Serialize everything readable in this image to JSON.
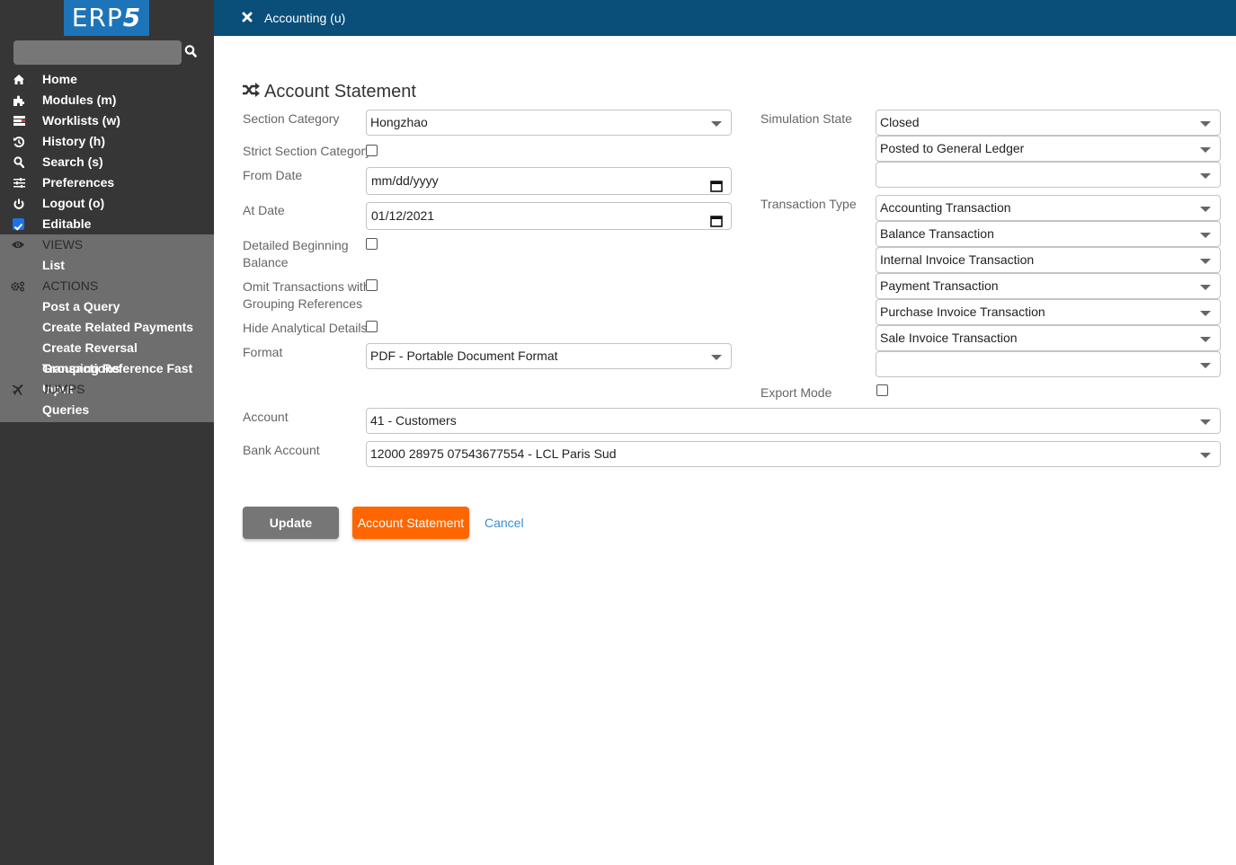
{
  "app": {
    "logo_text": "ERP",
    "logo_digit": "5",
    "brand_color": "#1d74b8",
    "header_color": "#0a4f7a",
    "accent_color": "#ff6600"
  },
  "sidebar": {
    "search": {
      "value": "",
      "placeholder": ""
    },
    "items": [
      {
        "label": "Home",
        "icon": "home-icon"
      },
      {
        "label": "Modules (m)",
        "icon": "puzzle-icon"
      },
      {
        "label": "Worklists (w)",
        "icon": "tasks-icon"
      },
      {
        "label": "History (h)",
        "icon": "history-icon"
      },
      {
        "label": "Search (s)",
        "icon": "search-icon"
      },
      {
        "label": "Preferences",
        "icon": "sliders-icon"
      },
      {
        "label": "Logout (o)",
        "icon": "power-icon"
      },
      {
        "label": "Editable",
        "icon": "checkbox-checked-icon",
        "checked": true
      }
    ],
    "sections": {
      "views": {
        "title": "VIEWS",
        "icon": "eye-icon",
        "items": [
          "List"
        ]
      },
      "actions": {
        "title": "ACTIONS",
        "icon": "cogs-icon",
        "items": [
          "Post a Query",
          "Create Related Payments",
          "Create Reversal Transactions",
          "Grouping Reference Fast Input"
        ]
      },
      "jumps": {
        "title": "JUMPS",
        "icon": "plane-icon",
        "items": [
          "Queries"
        ]
      }
    }
  },
  "header": {
    "title": "Accounting (u)",
    "close_icon": "close-icon"
  },
  "form": {
    "title": "Account Statement",
    "title_icon": "random-icon",
    "section_category": {
      "label": "Section Category",
      "value": "Hongzhao"
    },
    "strict_section_category": {
      "label": "Strict Section Category",
      "checked": false
    },
    "from_date": {
      "label": "From Date",
      "value": "",
      "placeholder": "mm/dd/yyyy"
    },
    "at_date": {
      "label": "At Date",
      "value": "01/12/2021"
    },
    "detailed_beginning_balance": {
      "label_line1": "Detailed Beginning",
      "label_line2": "Balance",
      "checked": false
    },
    "omit_grouping": {
      "label_line1": "Omit Transactions with",
      "label_line2": "Grouping References",
      "checked": false
    },
    "hide_analytical": {
      "label": "Hide Analytical Details",
      "checked": false
    },
    "format": {
      "label": "Format",
      "value": "PDF - Portable Document Format"
    },
    "simulation_state": {
      "label": "Simulation State",
      "values": [
        "Closed",
        "Posted to General Ledger",
        ""
      ]
    },
    "transaction_type": {
      "label": "Transaction Type",
      "values": [
        "Accounting Transaction",
        "Balance Transaction",
        "Internal Invoice Transaction",
        "Payment Transaction",
        "Purchase Invoice Transaction",
        "Sale Invoice Transaction",
        ""
      ]
    },
    "export_mode": {
      "label": "Export Mode",
      "checked": false
    },
    "account": {
      "label": "Account",
      "value": "41 - Customers"
    },
    "bank_account": {
      "label": "Bank Account",
      "value": "12000 28975 07543677554 - LCL Paris Sud"
    }
  },
  "buttons": {
    "update": "Update",
    "submit": "Account Statement",
    "cancel": "Cancel"
  }
}
